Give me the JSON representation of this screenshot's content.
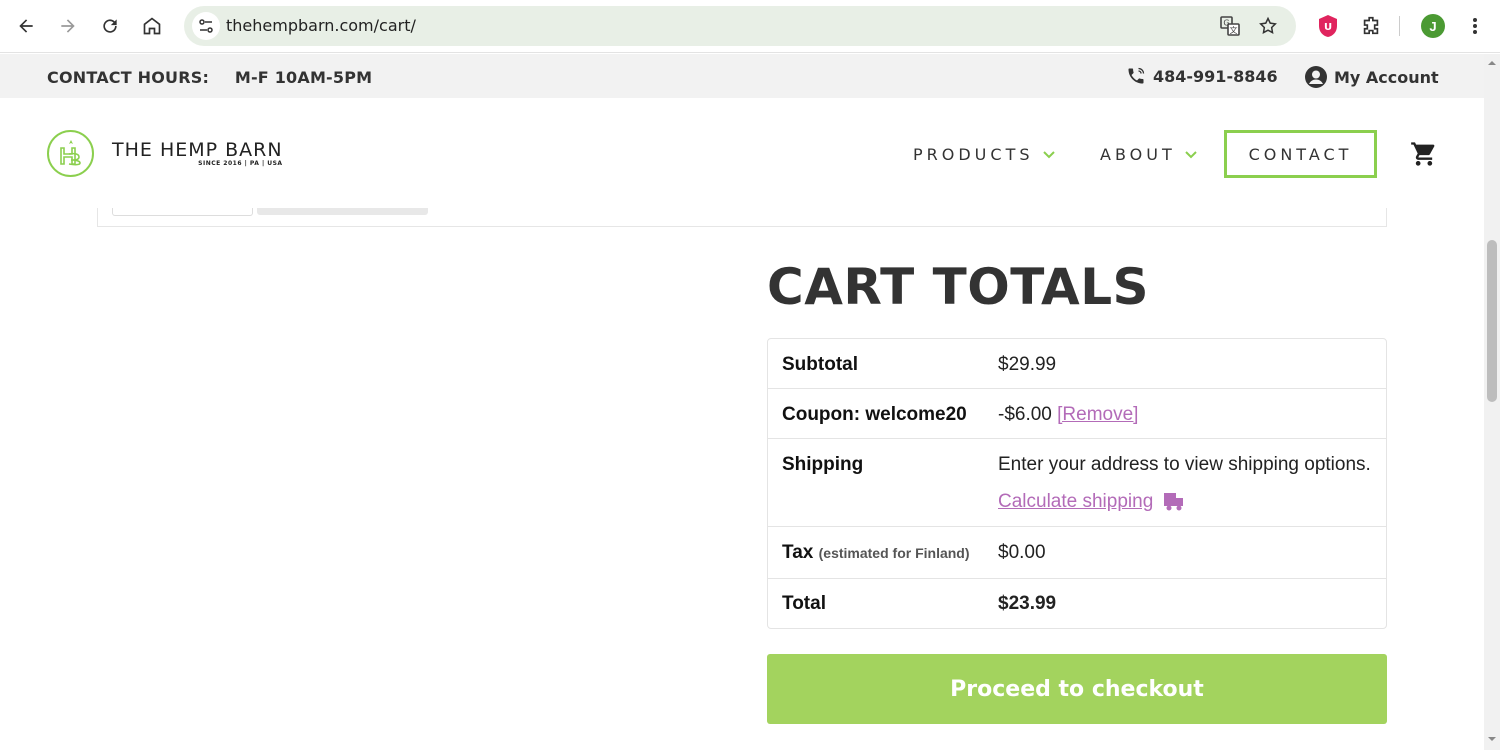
{
  "browser": {
    "url": "thehempbarn.com/cart/",
    "avatar_letter": "J"
  },
  "topbar": {
    "contact_label": "CONTACT HOURS:",
    "contact_hours": "M-F 10AM-5PM",
    "phone": "484-991-8846",
    "account": "My Account"
  },
  "header": {
    "logo_name": "THE HEMP BARN",
    "logo_tag": "SINCE 2016  |  PA  |  USA",
    "menu": {
      "products": "PRODUCTS",
      "about": "ABOUT",
      "contact": "CONTACT"
    }
  },
  "cart": {
    "title": "CART TOTALS",
    "subtotal_label": "Subtotal",
    "subtotal_value": "$29.99",
    "coupon_label": "Coupon: welcome20",
    "coupon_value": "-$6.00",
    "coupon_remove": "[Remove]",
    "shipping_label": "Shipping",
    "shipping_text": "Enter your address to view shipping options.",
    "shipping_link": "Calculate shipping",
    "tax_label": "Tax",
    "tax_note": "(estimated for Finland)",
    "tax_value": "$0.00",
    "total_label": "Total",
    "total_value": "$23.99",
    "checkout_button": "Proceed to checkout"
  },
  "colors": {
    "accent_green": "#8bcf4e",
    "checkout_green": "#a3d35e",
    "link_purple": "#b36bb8"
  }
}
